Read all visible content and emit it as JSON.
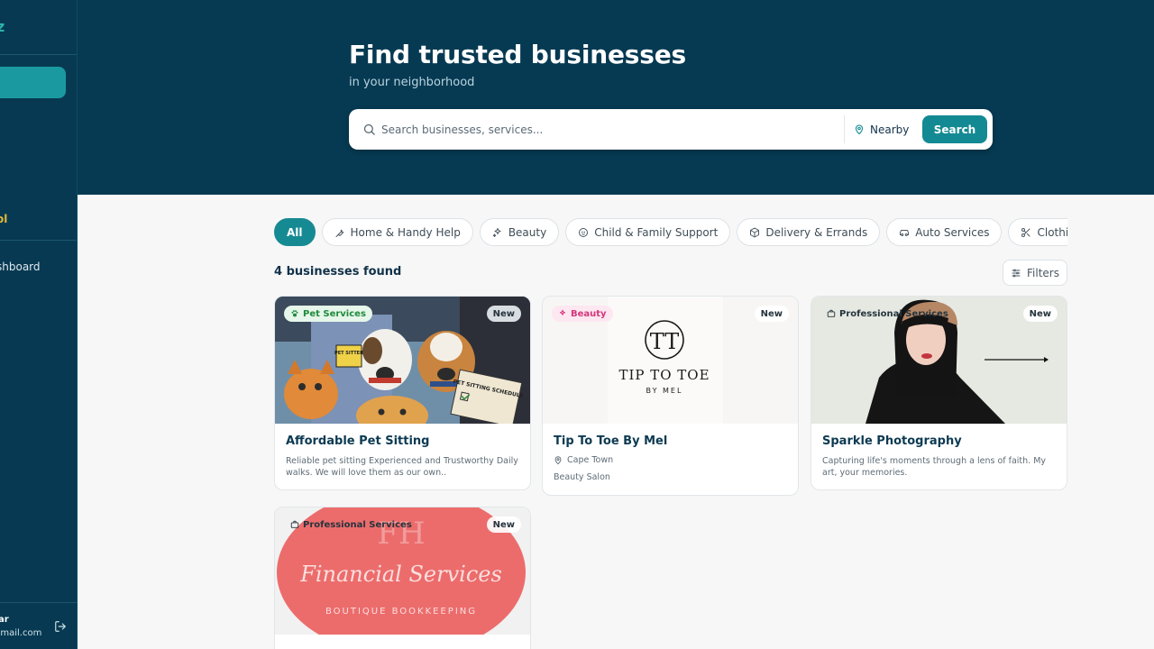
{
  "sidebar": {
    "logo_fragment": "z",
    "gold_fragment": "ol",
    "dashboard_fragment": "shboard",
    "user_name_fragment": "ar",
    "user_email_fragment": "gmail.com"
  },
  "hero": {
    "title": "Find trusted businesses",
    "subtitle": "in your neighborhood",
    "search_placeholder": "Search businesses, services...",
    "nearby_label": "Nearby",
    "search_button": "Search"
  },
  "categories": [
    {
      "label": "All",
      "icon": "none",
      "active": true
    },
    {
      "label": "Home & Handy Help",
      "icon": "wrench-icon",
      "active": false
    },
    {
      "label": "Beauty",
      "icon": "sparkles-icon",
      "active": false
    },
    {
      "label": "Child & Family Support",
      "icon": "baby-icon",
      "active": false
    },
    {
      "label": "Delivery & Errands",
      "icon": "package-icon",
      "active": false
    },
    {
      "label": "Auto Services",
      "icon": "car-icon",
      "active": false
    },
    {
      "label": "Clothing & Tailoring",
      "icon": "scissors-icon",
      "active": false
    }
  ],
  "results": {
    "count_label": "4 businesses found",
    "filters_label": "Filters"
  },
  "businesses": [
    {
      "category": "Pet Services",
      "badge": "New",
      "name": "Affordable Pet Sitting",
      "description": "Reliable pet sitting Experienced and Trustworthy Daily walks. We will love them as our own..",
      "image_text_1": "PET SITTER",
      "image_text_2": "PET SITTING SCHEDULE"
    },
    {
      "category": "Beauty",
      "badge": "New",
      "name": "Tip To Toe By Mel",
      "location": "Cape Town",
      "type": "Beauty Salon",
      "logo_monogram": "TT",
      "logo_line_1": "TIP TO TOE",
      "logo_line_2": "BY MEL"
    },
    {
      "category": "Professional Services",
      "badge": "New",
      "name": "Sparkle Photography",
      "description": "Capturing life's moments through a lens of faith. My art, your memories."
    },
    {
      "category": "Professional Services",
      "badge": "New",
      "logo_script": "Financial Services",
      "logo_sub": "BOUTIQUE BOOKKEEPING",
      "logo_monogram": "FH"
    }
  ],
  "colors": {
    "navy": "#063a52",
    "teal": "#138a93",
    "pet_badge_bg": "#e6f6ea",
    "pet_badge_fg": "#1f8a3c",
    "beauty_badge_bg": "#fde7f1",
    "beauty_badge_fg": "#d4367a"
  }
}
